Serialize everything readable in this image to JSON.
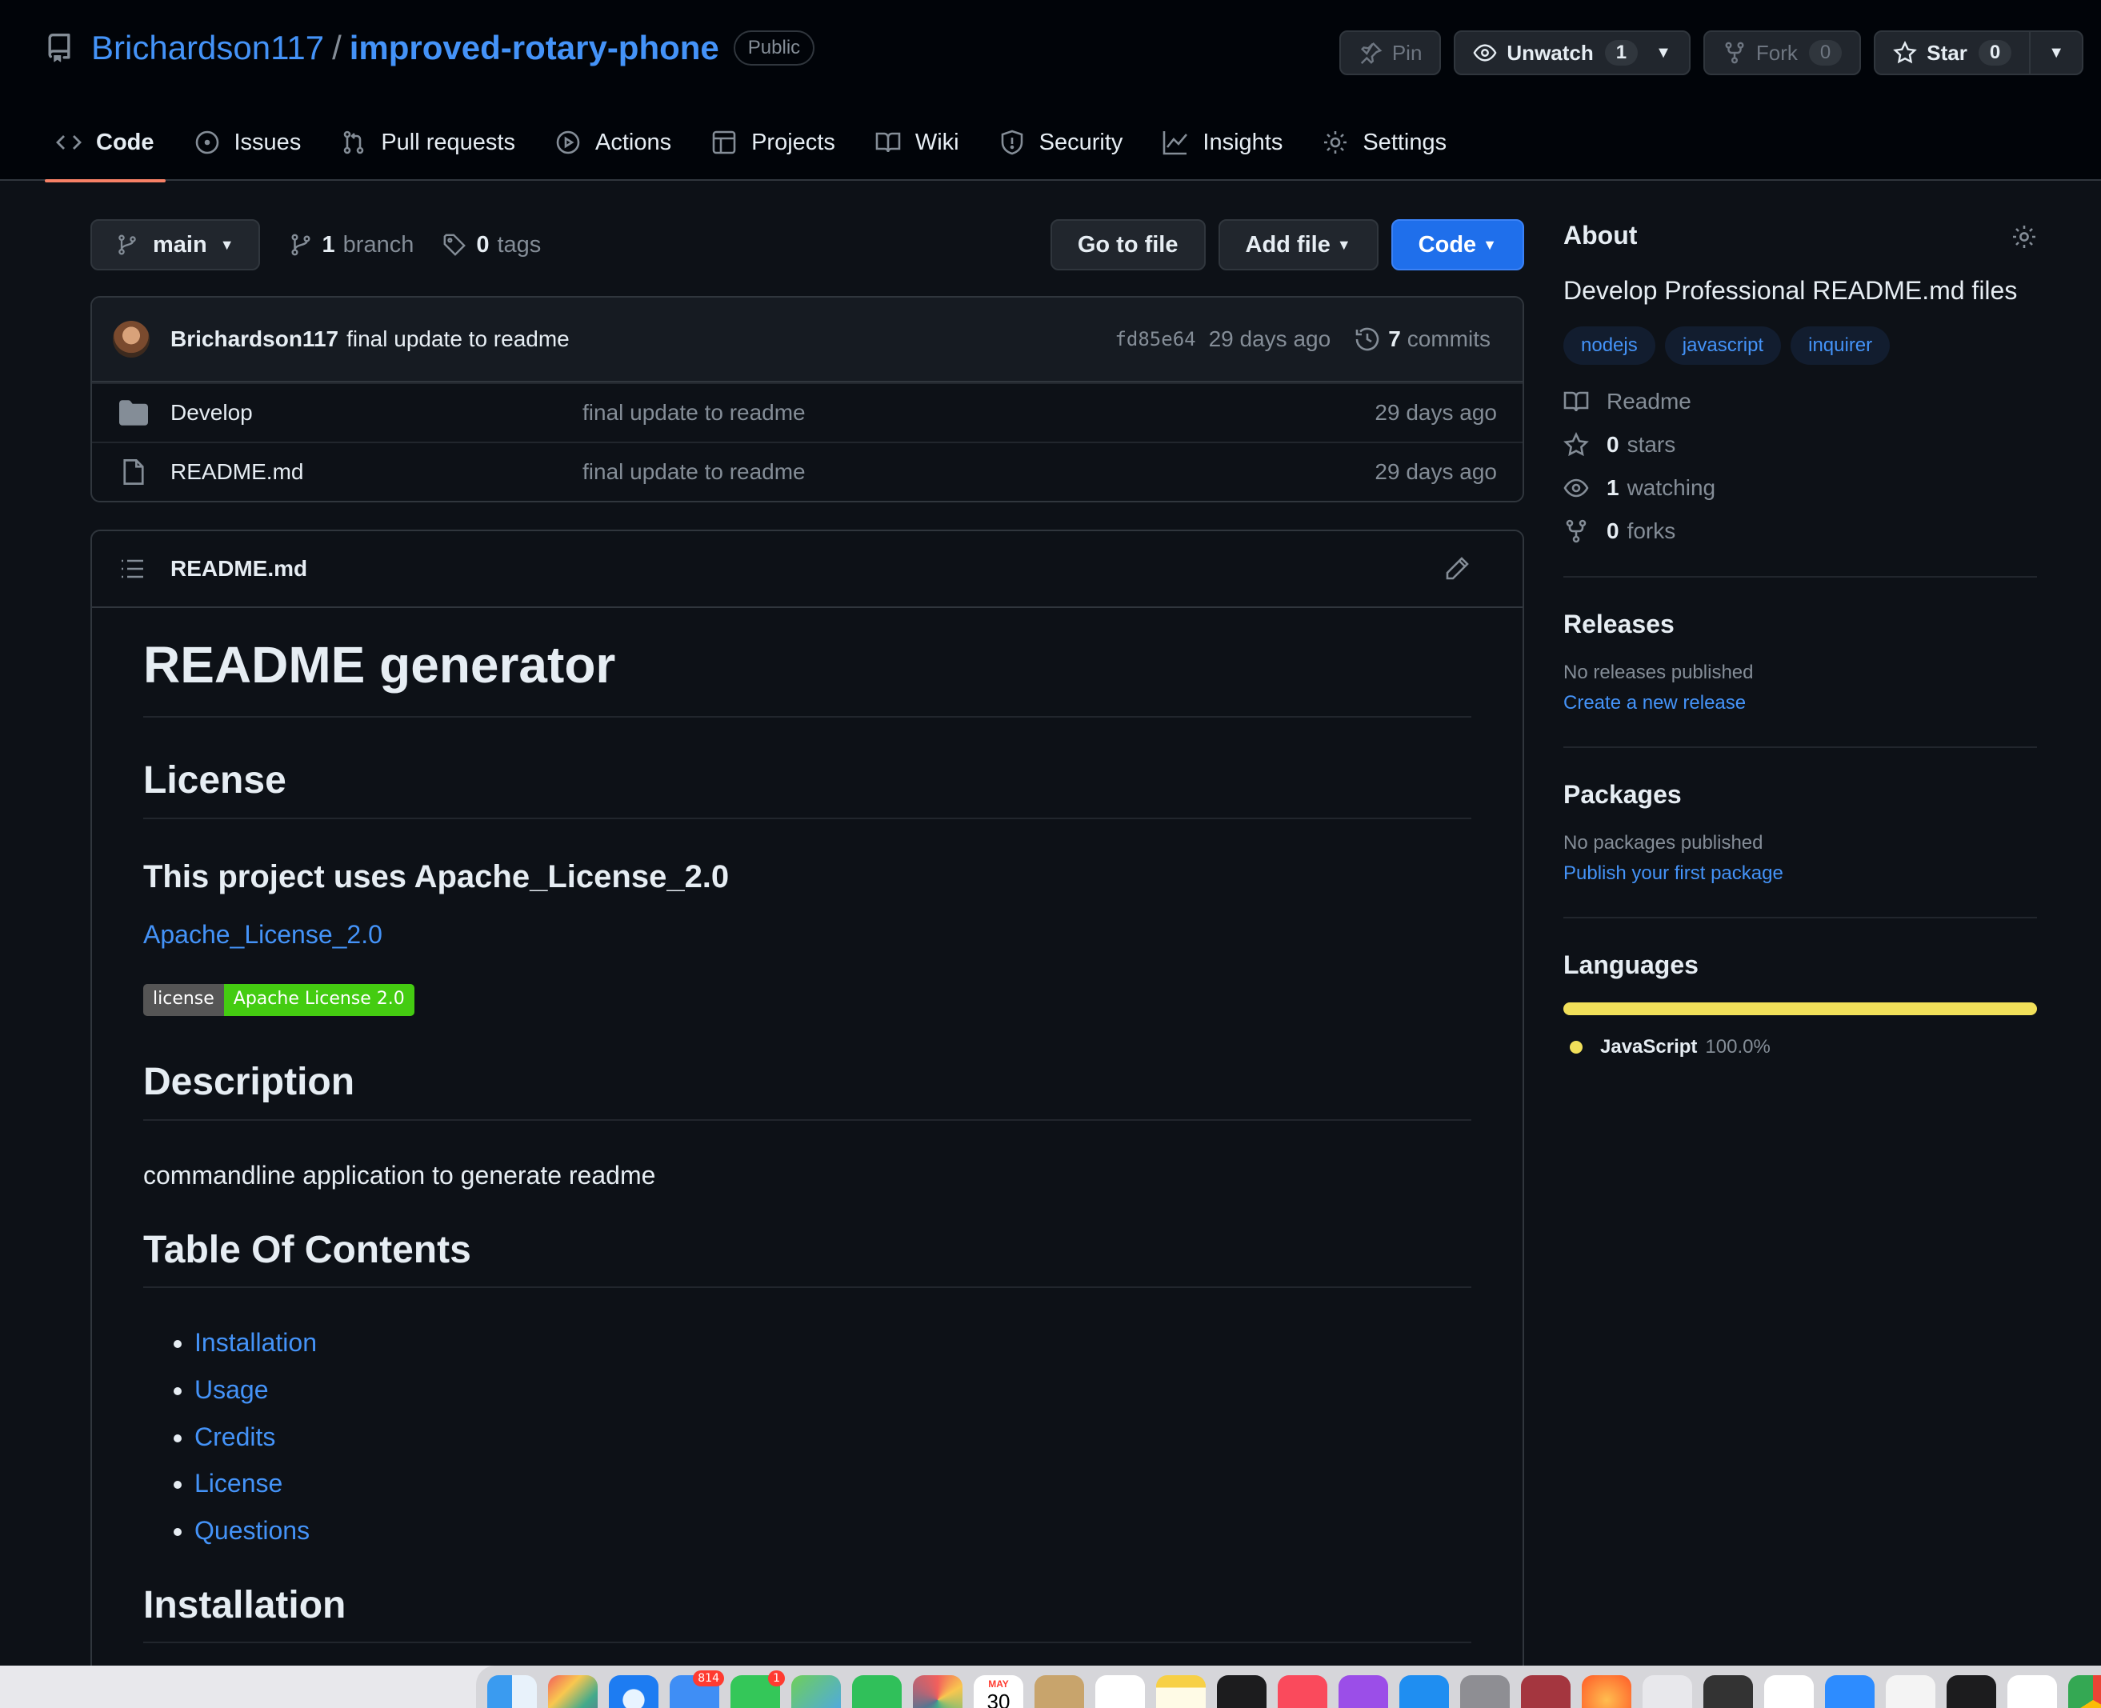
{
  "repo": {
    "owner": "Brichardson117",
    "separator": "/",
    "name": "improved-rotary-phone",
    "visibility": "Public"
  },
  "header_buttons": {
    "pin": "Pin",
    "unwatch": "Unwatch",
    "watch_count": "1",
    "fork": "Fork",
    "fork_count": "0",
    "star": "Star",
    "star_count": "0"
  },
  "tabs": [
    {
      "label": "Code",
      "icon": "code-icon",
      "active": true
    },
    {
      "label": "Issues",
      "icon": "issue-icon"
    },
    {
      "label": "Pull requests",
      "icon": "pull-request-icon"
    },
    {
      "label": "Actions",
      "icon": "play-icon"
    },
    {
      "label": "Projects",
      "icon": "table-icon"
    },
    {
      "label": "Wiki",
      "icon": "book-icon"
    },
    {
      "label": "Security",
      "icon": "shield-icon"
    },
    {
      "label": "Insights",
      "icon": "graph-icon"
    },
    {
      "label": "Settings",
      "icon": "gear-icon"
    }
  ],
  "file_nav": {
    "branch": "main",
    "branch_count": "1",
    "branch_label": "branch",
    "tag_count": "0",
    "tag_label": "tags",
    "go_to_file": "Go to file",
    "add_file": "Add file",
    "code": "Code"
  },
  "latest_commit": {
    "author": "Brichardson117",
    "message": "final update to readme",
    "sha": "fd85e64",
    "age": "29 days ago",
    "commit_count": "7",
    "commit_label": "commits"
  },
  "files": [
    {
      "name": "Develop",
      "type": "folder",
      "message": "final update to readme",
      "age": "29 days ago"
    },
    {
      "name": "README.md",
      "type": "file",
      "message": "final update to readme",
      "age": "29 days ago"
    }
  ],
  "readme": {
    "filename": "README.md",
    "title": "README generator",
    "license_heading": "License",
    "license_sub": "This project uses Apache_License_2.0",
    "license_link": "Apache_License_2.0",
    "badge_left": "license",
    "badge_right": "Apache License 2.0",
    "description_heading": "Description",
    "description": "commandline application to generate readme",
    "toc_heading": "Table Of Contents",
    "toc": [
      "Installation",
      "Usage",
      "Credits",
      "License",
      "Questions"
    ],
    "installation_heading": "Installation"
  },
  "about": {
    "title": "About",
    "description": "Develop Professional README.md files",
    "topics": [
      "nodejs",
      "javascript",
      "inquirer"
    ],
    "readme": "Readme",
    "stars_count": "0",
    "stars_label": "stars",
    "watching_count": "1",
    "watching_label": "watching",
    "forks_count": "0",
    "forks_label": "forks"
  },
  "releases": {
    "title": "Releases",
    "none": "No releases published",
    "link": "Create a new release"
  },
  "packages": {
    "title": "Packages",
    "none": "No packages published",
    "link": "Publish your first package"
  },
  "languages": {
    "title": "Languages",
    "items": [
      {
        "name": "JavaScript",
        "percent": "100.0%",
        "color": "#f1e05a"
      }
    ]
  },
  "dock": {
    "badges": {
      "mail": "814",
      "messages": "1"
    },
    "calendar_month": "MAY",
    "calendar_day": "30"
  }
}
